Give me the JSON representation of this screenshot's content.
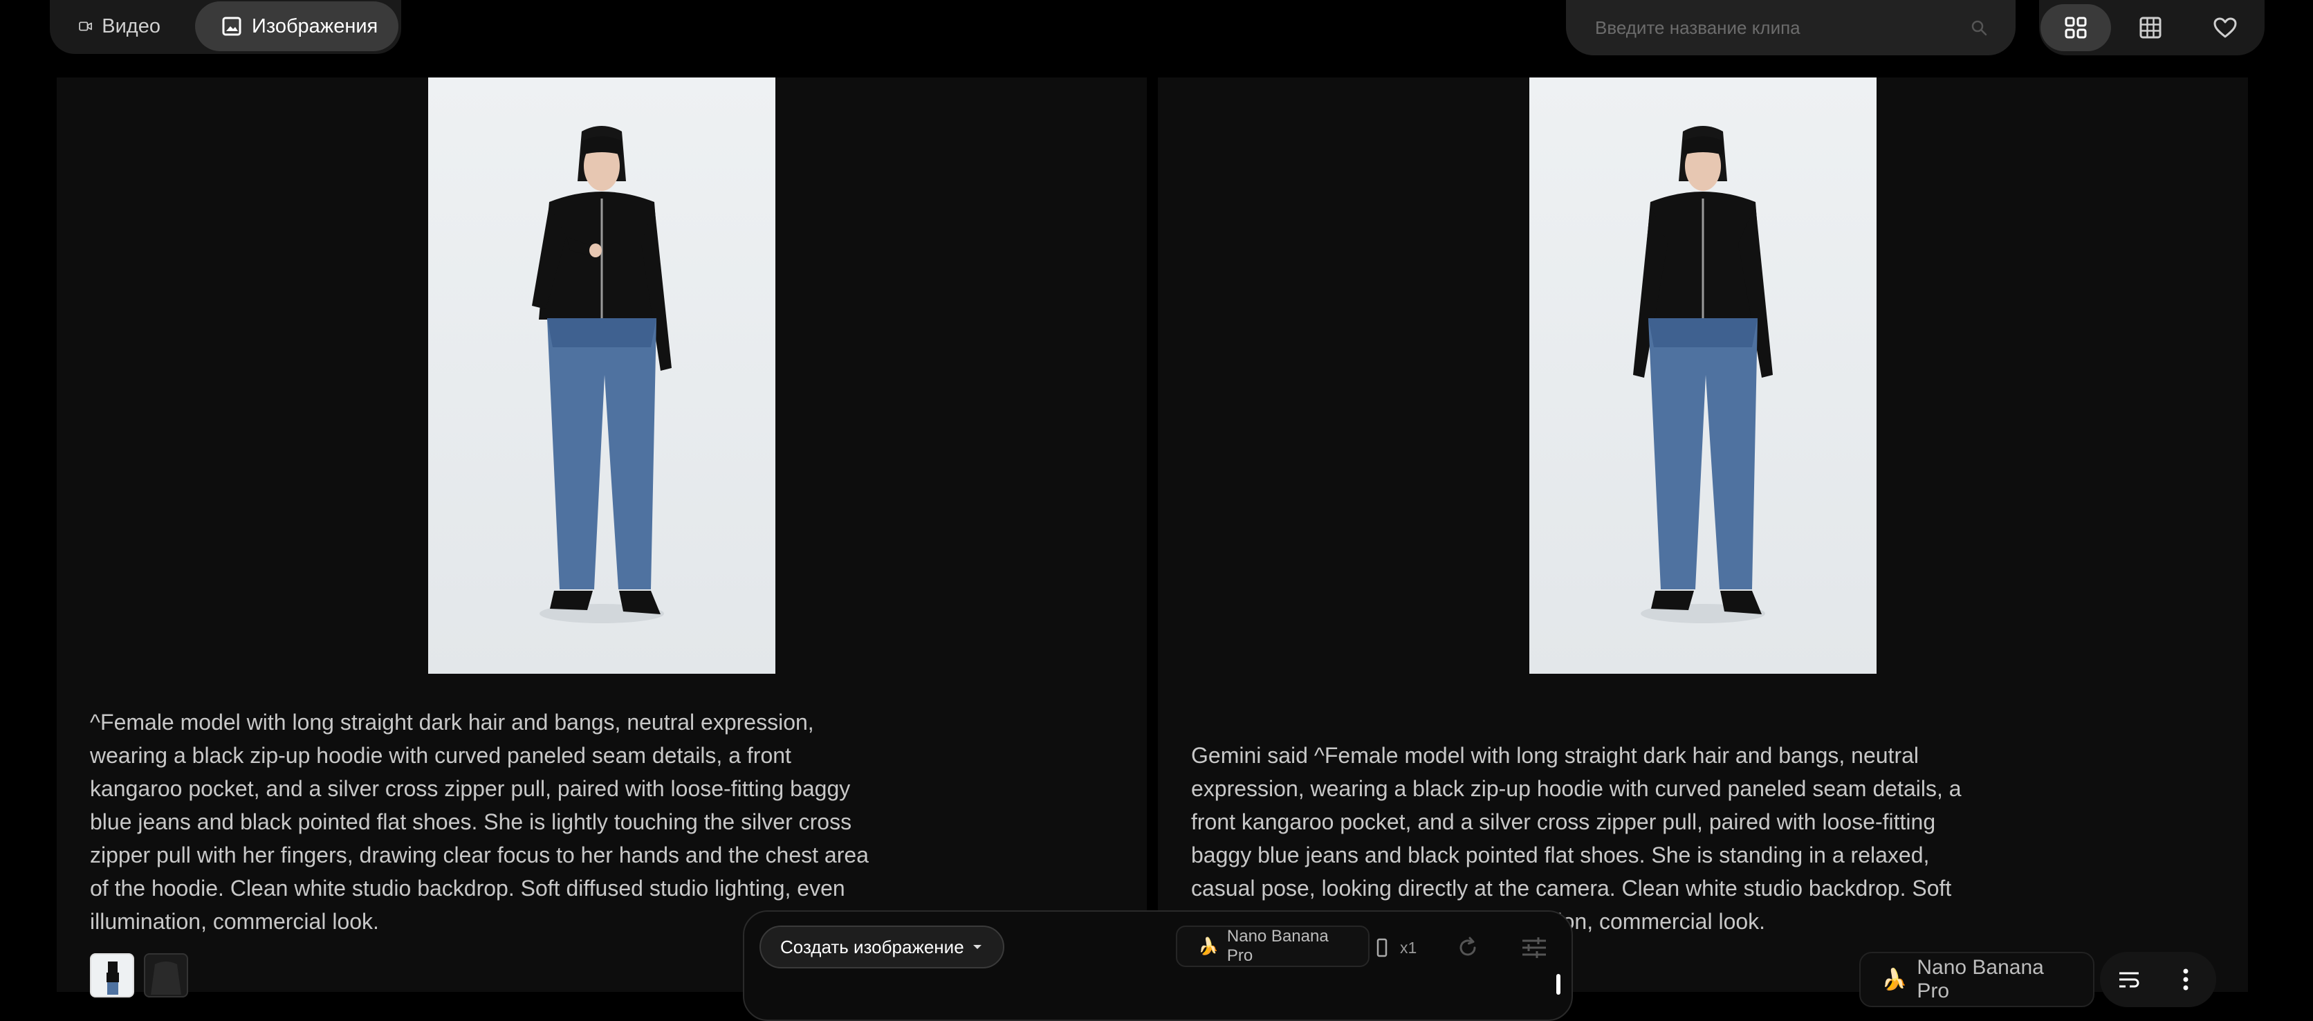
{
  "tabs": [
    {
      "label": "Видео",
      "icon": "video-camera-icon",
      "active": false
    },
    {
      "label": "Изображения",
      "icon": "image-icon",
      "active": true
    }
  ],
  "search": {
    "placeholder": "Введите название клипа",
    "value": ""
  },
  "view_controls": [
    "grid-view-icon",
    "table-view-icon",
    "favorites-heart-icon"
  ],
  "cards": [
    {
      "caption": "^Female model with long straight dark hair and bangs, neutral expression, wearing a black zip-up hoodie with curved paneled seam details, a front kangaroo pocket, and a silver cross zipper pull, paired with loose-fitting baggy blue jeans and black pointed flat shoes. She is lightly touching the silver cross zipper pull with her fingers, drawing clear focus to her hands and the chest area of the hoodie. Clean white studio backdrop. Soft diffused studio lighting, even illumination, commercial look."
    },
    {
      "caption": "Gemini said ^Female model with long straight dark hair and bangs, neutral expression, wearing a black zip-up hoodie with curved paneled seam details, a front kangaroo pocket, and a silver cross zipper pull, paired with loose-fitting baggy blue jeans and black pointed flat shoes. She is standing in a relaxed, casual pose, looking directly at the camera. Clean white studio backdrop. Soft diffused studio lighting, even illumination, commercial look.",
      "model": "Nano Banana Pro"
    }
  ],
  "composer": {
    "create_label": "Создать изображение",
    "model": "Nano Banana Pro",
    "count": "x1"
  },
  "colors": {
    "background": "#000000",
    "panel": "#0d0d0d",
    "active_tab": "#3a3a3a"
  }
}
